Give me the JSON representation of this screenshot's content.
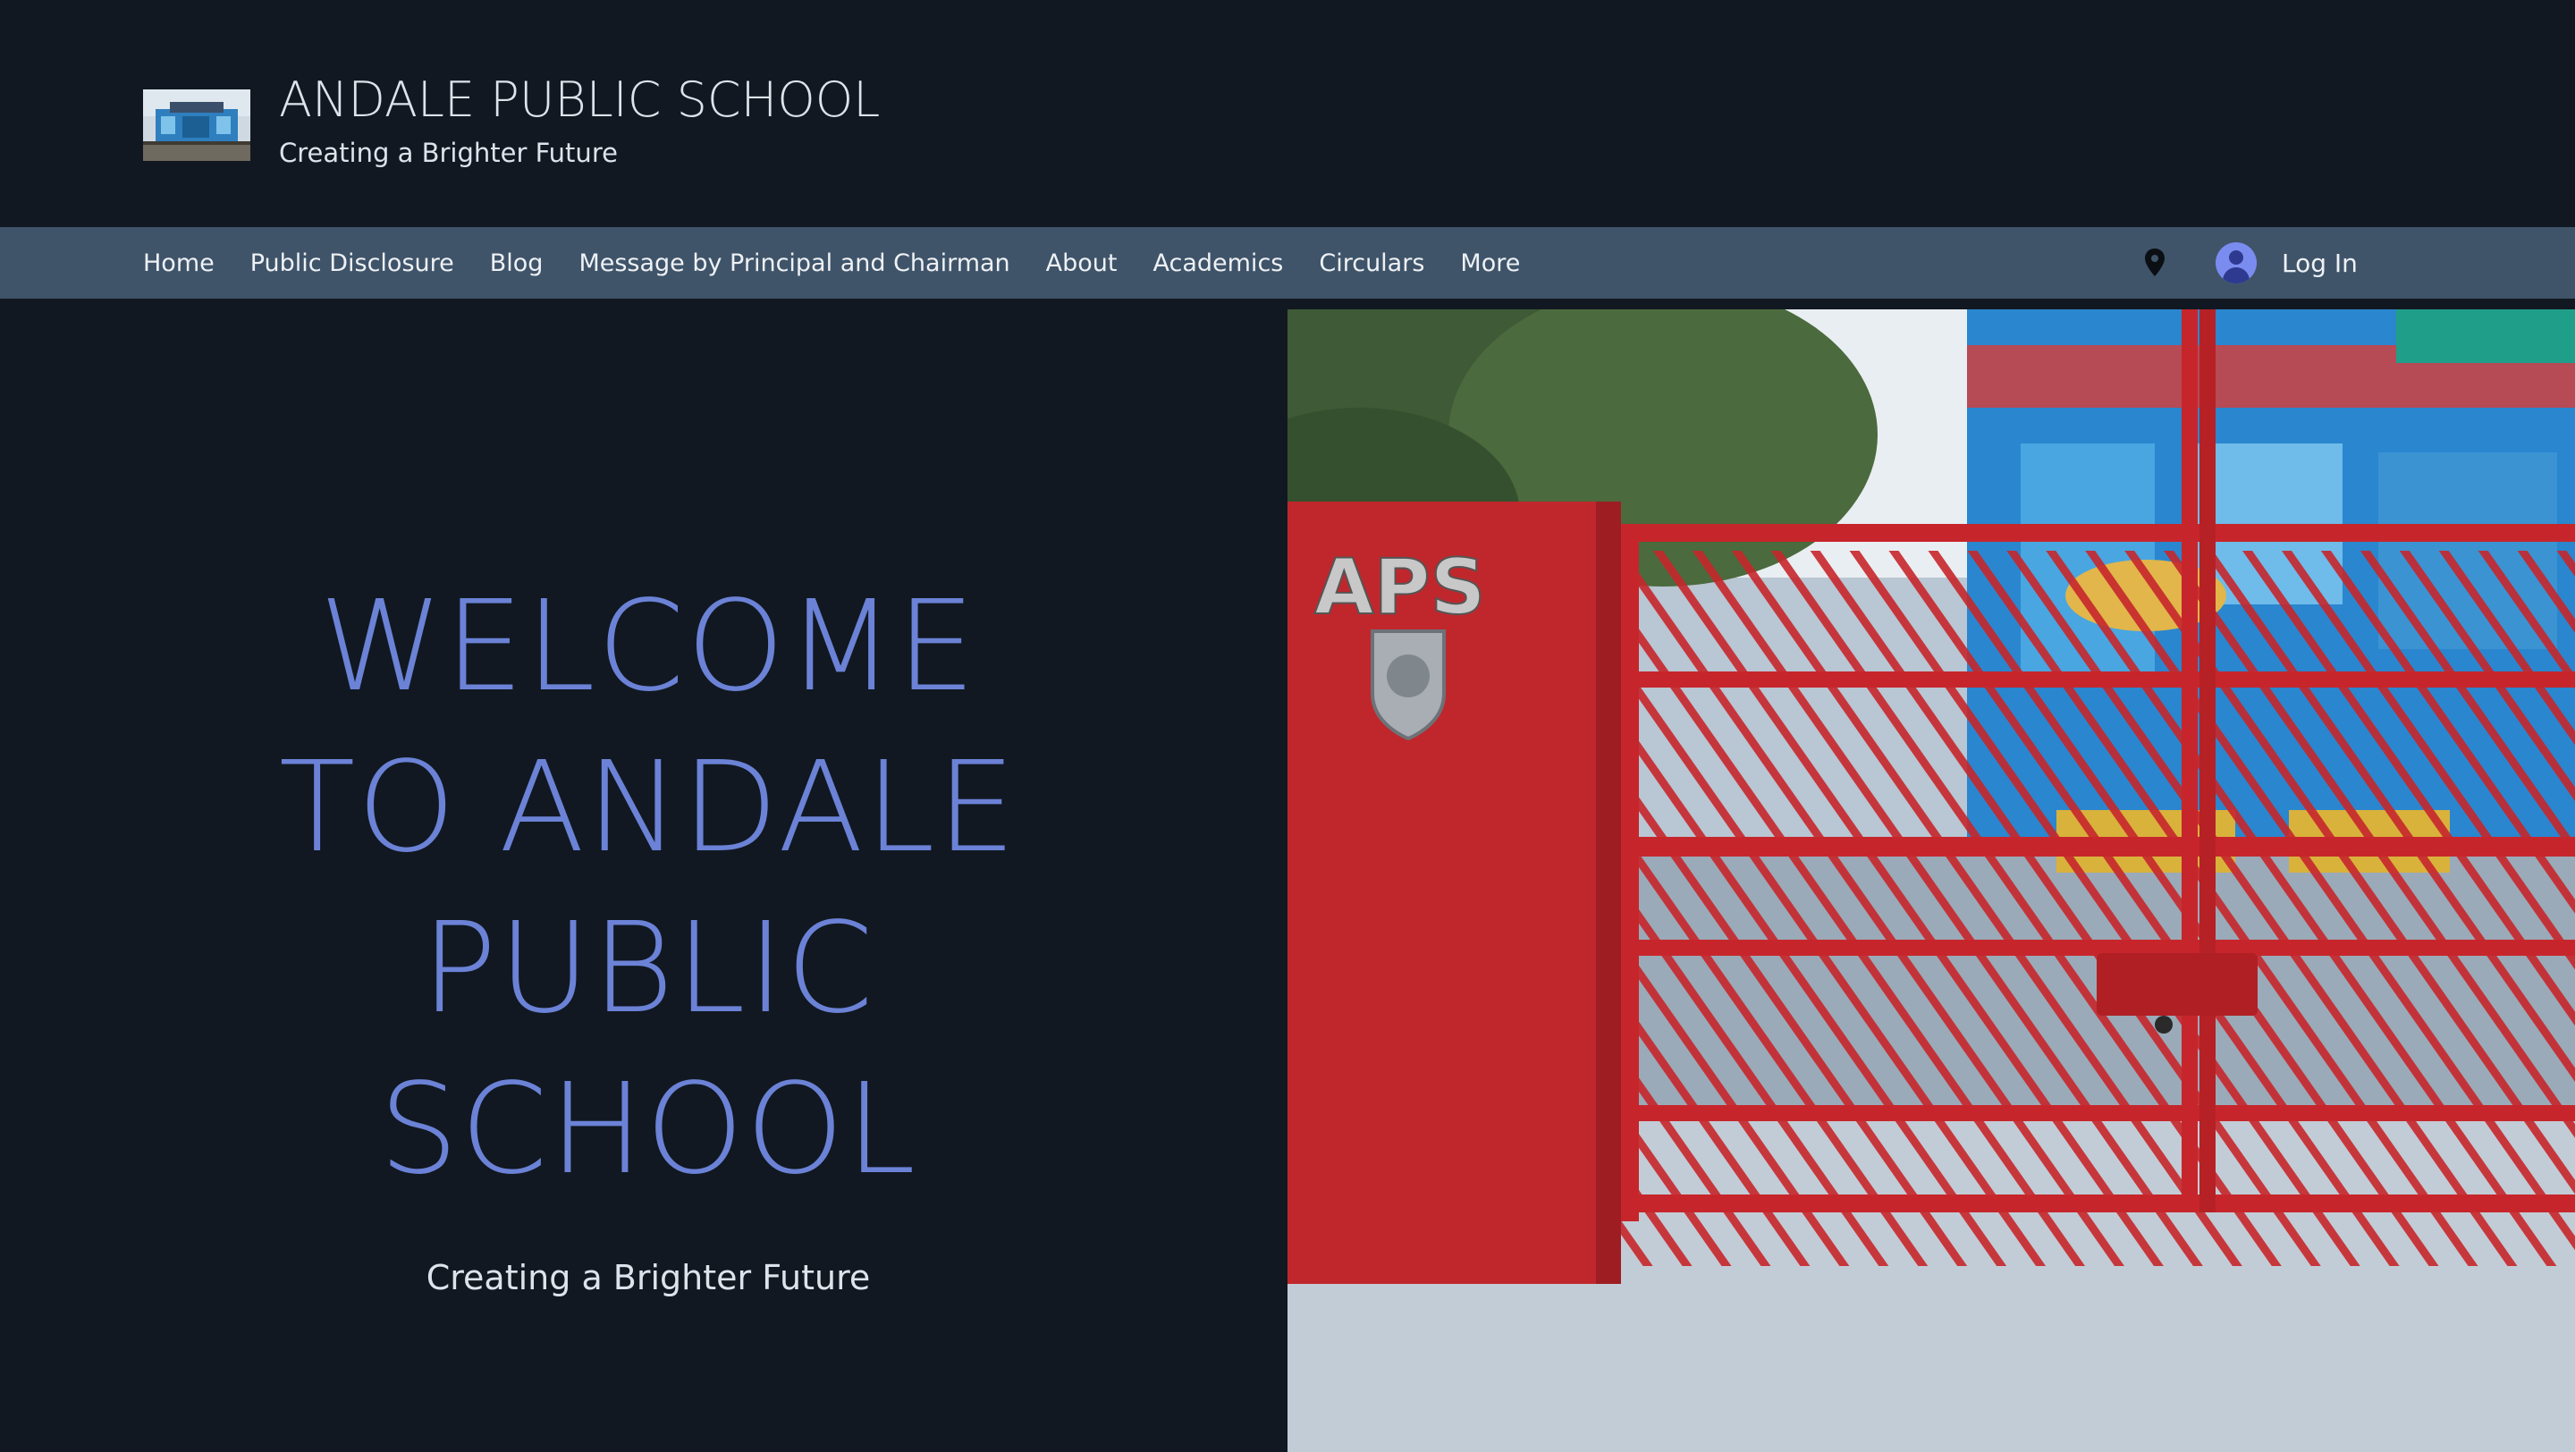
{
  "header": {
    "site_title": "ANDALE PUBLIC SCHOOL",
    "tagline": "Creating a Brighter Future",
    "logo_icon": "school-building-thumbnail"
  },
  "nav": {
    "items": [
      {
        "label": "Home"
      },
      {
        "label": "Public Disclosure"
      },
      {
        "label": "Blog"
      },
      {
        "label": "Message by Principal and Chairman"
      },
      {
        "label": "About"
      },
      {
        "label": "Academics"
      },
      {
        "label": "Circulars"
      },
      {
        "label": "More"
      }
    ],
    "location_icon": "map-pin-icon",
    "login_label": "Log In",
    "avatar_icon": "user-avatar-icon"
  },
  "hero": {
    "heading_lines": [
      "WELCOME",
      "TO ANDALE",
      "PUBLIC",
      "SCHOOL"
    ],
    "tagline": "Creating a Brighter Future",
    "image_icon": "school-gate-photo",
    "gate_sign": "APS"
  },
  "colors": {
    "background": "#111821",
    "nav_bar": "#3f5469",
    "heading_accent": "#6b82d6",
    "text_light": "#dde3ea",
    "avatar": "#7b8cf0"
  }
}
